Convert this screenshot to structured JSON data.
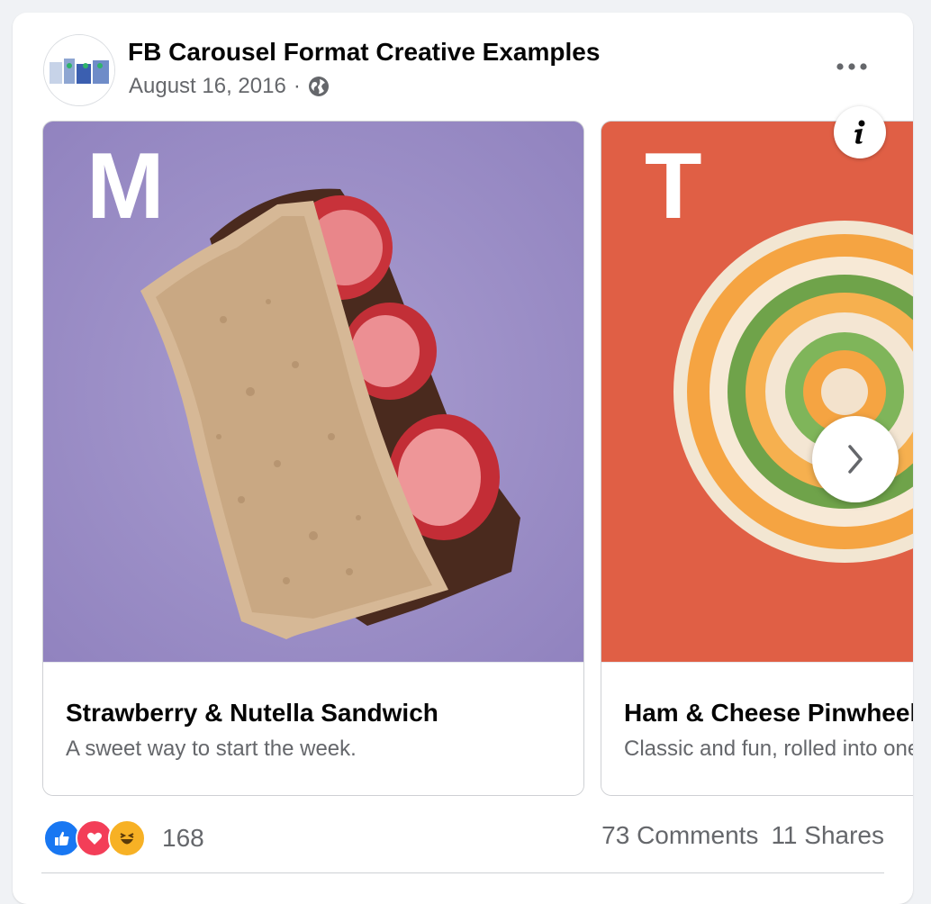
{
  "post": {
    "page_name": "FB Carousel Format Creative Examples",
    "date": "August 16, 2016",
    "separator": "·",
    "audience_icon": "globe-icon",
    "more_icon": "more-horizontal-icon"
  },
  "carousel": {
    "cards": [
      {
        "letter": "M",
        "title": "Strawberry & Nutella Sandwich",
        "description": "A sweet way to start the week.",
        "background_color": "#a498cb"
      },
      {
        "letter": "T",
        "title": "Ham & Cheese Pinwheels",
        "description": "Classic and fun, rolled into one.",
        "background_color": "#e2644a"
      }
    ],
    "info_icon": "info-icon",
    "next_icon": "chevron-right-icon"
  },
  "footer": {
    "reaction_icons": [
      "like-icon",
      "love-icon",
      "haha-icon"
    ],
    "reaction_count": "168",
    "comments": "73 Comments",
    "shares": "11 Shares"
  },
  "colors": {
    "like": "#1877f2",
    "love": "#f33e58",
    "haha": "#f7b125",
    "text_secondary": "#65676b"
  }
}
